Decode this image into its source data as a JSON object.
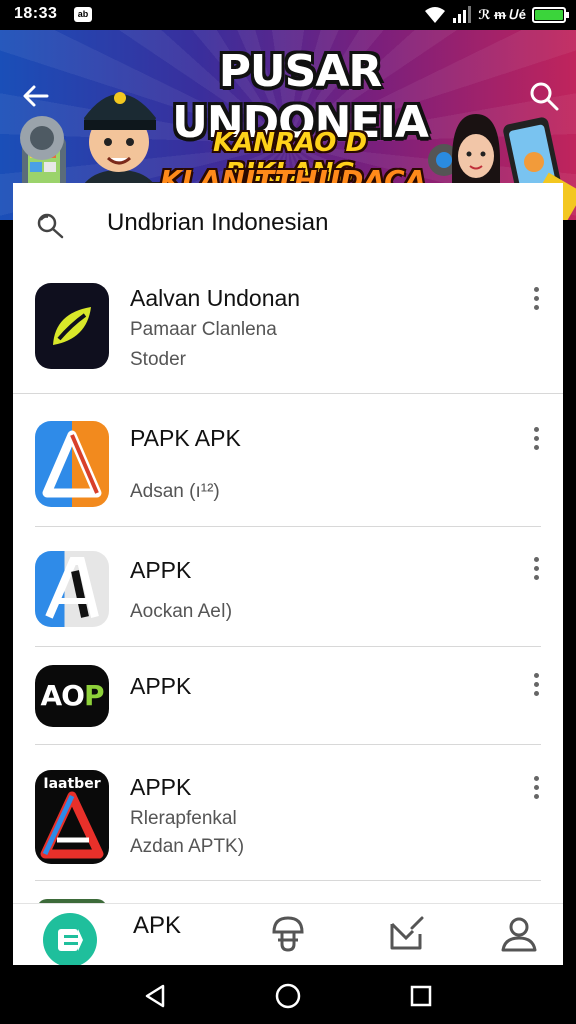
{
  "status_bar": {
    "time": "18:33",
    "app_badge": "ab",
    "extra": "ℛ ᵯ 𝑈é",
    "battery_level": 1.0
  },
  "banner": {
    "title": "PUSAR UNDONEIA",
    "subtitle_1": "KANRAO D BIKLANG",
    "subtitle_2": "KLANITTHUDACA",
    "back_icon": "arrow-left-icon",
    "search_icon": "search-icon"
  },
  "search": {
    "query": "Undbrian Indonesian",
    "icon": "search-icon"
  },
  "apps": [
    {
      "name": "Aalvan Undonan",
      "sub1": "Pamaar Clanlena",
      "sub2": "Stoder",
      "icon": "leaf-app-icon",
      "icon_bg": "#0f0f1e",
      "accent": "#d9e82a"
    },
    {
      "name": "PAPK APK",
      "sub1": "Adsan (ı¹²)",
      "sub2": "",
      "icon": "triangle-a-app-icon",
      "icon_bg": "#2f8be8",
      "accent": "#f28a1e"
    },
    {
      "name": "APPK",
      "sub1": "Aockan Aeǀ)",
      "sub2": "",
      "icon": "a-letter-app-icon",
      "icon_bg": "#e6e6e6",
      "accent": "#2f8be8"
    },
    {
      "name": "APPK",
      "sub1": "",
      "sub2": "",
      "icon": "aop-app-icon",
      "icon_bg": "#0a0a0a",
      "accent": "#8ed13a",
      "icon_text": "AOP"
    },
    {
      "name": "APPK",
      "sub1": "Rlerapfenkal",
      "sub2": "Azdan APTK)",
      "icon": "red-a-app-icon",
      "icon_bg": "#0a0a0a",
      "accent": "#e8302a",
      "icon_text": "Iaatber"
    }
  ],
  "bottom_nav": {
    "items": [
      {
        "label": "",
        "icon": "home-app-icon"
      },
      {
        "label": "APK",
        "icon": ""
      },
      {
        "label": "",
        "icon": "mushroom-icon"
      },
      {
        "label": "",
        "icon": "envelope-edit-icon"
      },
      {
        "label": "",
        "icon": "profile-icon"
      }
    ]
  },
  "system_nav": {
    "back": "back-triangle-icon",
    "home": "home-circle-icon",
    "recents": "recents-square-icon"
  }
}
